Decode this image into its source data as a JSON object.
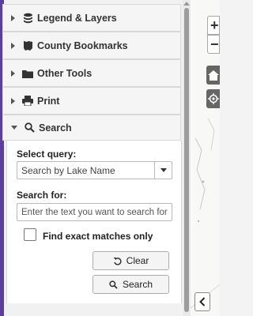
{
  "accordion": [
    {
      "label": "Legend & Layers",
      "icon": "layers-icon"
    },
    {
      "label": "County Bookmarks",
      "icon": "ohio-map-icon"
    },
    {
      "label": "Other Tools",
      "icon": "folder-icon"
    },
    {
      "label": "Print",
      "icon": "printer-icon"
    },
    {
      "label": "Search",
      "icon": "search-icon",
      "expanded": true
    }
  ],
  "search": {
    "select_label": "Select query:",
    "select_value": "Search by Lake Name",
    "search_for_label": "Search for:",
    "search_placeholder": "Enter the text you want to search for",
    "exact_label": "Find exact matches only",
    "exact_checked": false,
    "clear_label": "Clear",
    "search_button_label": "Search"
  },
  "map_controls": {
    "zoom_in": "+",
    "zoom_out": "−"
  },
  "colors": {
    "purple_edge": "#5b3f9a",
    "scroll_thumb": "#9c9c9c",
    "map_button_dark": "#666666"
  }
}
